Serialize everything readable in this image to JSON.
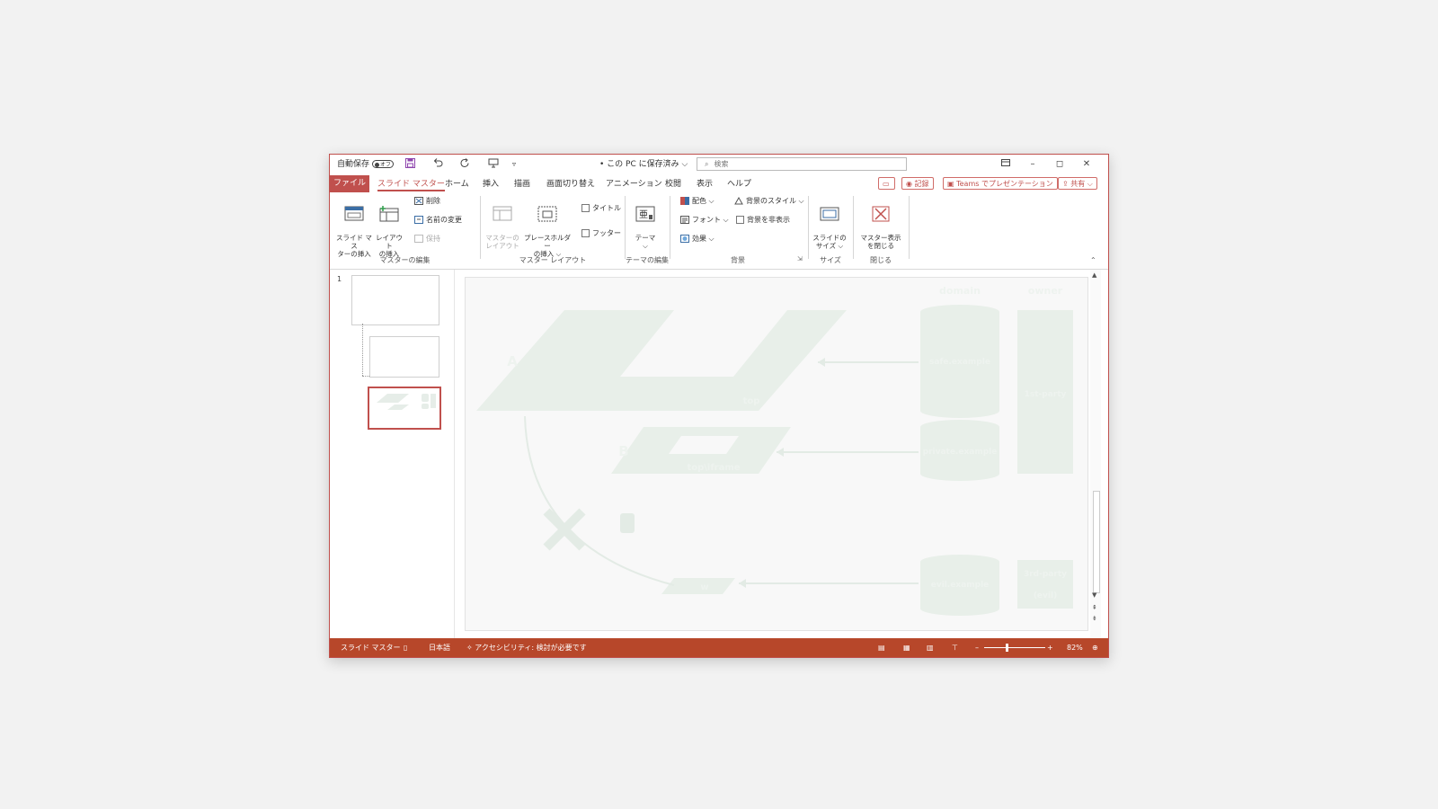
{
  "titlebar": {
    "autosave_label": "自動保存",
    "autosave_state": "オフ",
    "doc_status": "• この PC に保存済み ⌵",
    "search_placeholder": "検索"
  },
  "tabs": {
    "file": "ファイル",
    "items": [
      "スライド マスター",
      "ホーム",
      "挿入",
      "描画",
      "画面切り替え",
      "アニメーション",
      "校閲",
      "表示",
      "ヘルプ"
    ],
    "record": "記録",
    "teams": "Teams でプレゼンテーション",
    "share": "共有"
  },
  "ribbon": {
    "insert_master": "スライド マス\nターの挿入",
    "insert_layout": "レイアウト\nの挿入",
    "delete": "削除",
    "rename": "名前の変更",
    "preserve": "保持",
    "group_master_edit": "マスターの編集",
    "master_layout": "マスターの\nレイアウト",
    "insert_placeholder": "プレースホルダー\nの挿入 ⌵",
    "title_cb": "タイトル",
    "footer_cb": "フッター",
    "group_master_layout": "マスター レイアウト",
    "theme": "テーマ\n⌵",
    "group_theme_edit": "テーマの編集",
    "colors": "配色 ⌵",
    "fonts": "フォント ⌵",
    "effects": "効果 ⌵",
    "bg_styles": "背景のスタイル ⌵",
    "hide_bg": "背景を非表示",
    "group_background": "背景",
    "slide_size": "スライドの\nサイズ ⌵",
    "group_size": "サイズ",
    "close_master": "マスター表示\nを閉じる",
    "group_close": "閉じる"
  },
  "thumbs": {
    "slide_number": "1"
  },
  "slide": {
    "header_domain": "domain",
    "header_owner": "owner",
    "label_a": "A",
    "label_b": "B",
    "top_window": "top",
    "iframe_window": "top\\iframe",
    "bottom_window": "w",
    "db_top": "safe.example",
    "db_mid": "private.example",
    "db_bottom": "evil.example",
    "owner_top": "1st-party",
    "owner_bottom_1": "3rd-party",
    "owner_bottom_2": "(evil)"
  },
  "status": {
    "mode": "スライド マスター",
    "language": "日本語",
    "accessibility": "アクセシビリティ: 検討が必要です",
    "zoom": "82%"
  },
  "colors": {
    "accent": "#c0504d",
    "status_bar": "#b7472a"
  }
}
